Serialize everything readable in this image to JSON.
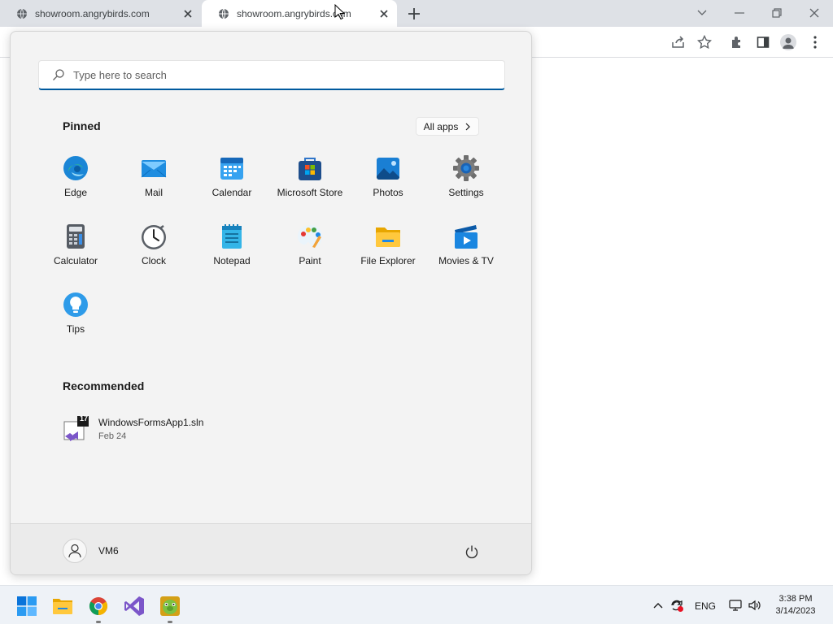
{
  "browser": {
    "tabs": [
      {
        "title": "showroom.angrybirds.com"
      },
      {
        "title": "showroom.angrybirds.com"
      }
    ]
  },
  "start_menu": {
    "search_placeholder": "Type here to search",
    "pinned_title": "Pinned",
    "all_apps_label": "All apps",
    "pinned_apps": [
      {
        "label": "Edge",
        "icon": "edge-icon"
      },
      {
        "label": "Mail",
        "icon": "mail-icon"
      },
      {
        "label": "Calendar",
        "icon": "calendar-icon"
      },
      {
        "label": "Microsoft Store",
        "icon": "store-icon"
      },
      {
        "label": "Photos",
        "icon": "photos-icon"
      },
      {
        "label": "Settings",
        "icon": "settings-gear-icon"
      },
      {
        "label": "Calculator",
        "icon": "calculator-icon"
      },
      {
        "label": "Clock",
        "icon": "clock-icon"
      },
      {
        "label": "Notepad",
        "icon": "notepad-icon"
      },
      {
        "label": "Paint",
        "icon": "paint-palette-icon"
      },
      {
        "label": "File Explorer",
        "icon": "folder-icon"
      },
      {
        "label": "Movies & TV",
        "icon": "movies-play-icon"
      },
      {
        "label": "Tips",
        "icon": "lightbulb-icon"
      }
    ],
    "recommended_title": "Recommended",
    "recommended": [
      {
        "name": "WindowsFormsApp1.sln",
        "date": "Feb 24",
        "badge": "17"
      }
    ],
    "user_name": "VM6"
  },
  "taskbar": {
    "language": "ENG",
    "time": "3:38 PM",
    "date": "3/14/2023"
  }
}
